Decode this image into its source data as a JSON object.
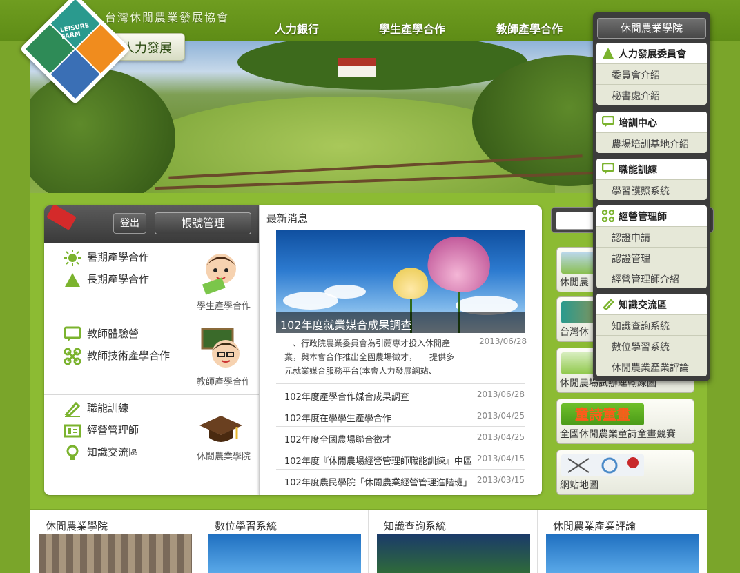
{
  "header": {
    "org_name": "台灣休閒農業發展協會",
    "logo_text": "LEISURE FARM",
    "site_tag": "人力發展",
    "nav": [
      {
        "label": "人力銀行"
      },
      {
        "label": "學生產學合作"
      },
      {
        "label": "教師產學合作"
      },
      {
        "label": "休閒農業學院"
      }
    ]
  },
  "account": {
    "logout_label": "登出",
    "account_label": "帳號管理"
  },
  "left_sections": [
    {
      "links": [
        "暑期產學合作",
        "長期產學合作"
      ],
      "caption": "學生產學合作"
    },
    {
      "links": [
        "教師體驗營",
        "教師技術產學合作"
      ],
      "caption": "教師產學合作"
    },
    {
      "links": [
        "職能訓練",
        "經營管理師",
        "知識交流區"
      ],
      "caption": "休閒農業學院"
    }
  ],
  "news": {
    "title": "最新消息",
    "featured_caption": "102年度就業媒合成果調查",
    "featured_desc": "一、行政院農業委員會為引薦專才投入休閒產業，與本會合作推出全國農場徵才，　　提供多元就業媒合服務平台(本會人力發展網站、",
    "featured_date": "2013/06/28",
    "items": [
      {
        "title": "102年度產學合作媒合成果調查",
        "date": "2013/06/28"
      },
      {
        "title": "102年度在學學生產學合作",
        "date": "2013/04/25"
      },
      {
        "title": "102年度全國農場聯合徵才",
        "date": "2013/04/25"
      },
      {
        "title": "102年度『休閒農場經營管理師職能訓練』中區",
        "date": "2013/04/15"
      },
      {
        "title": "102年度農民學院「休閒農業經營管理進階班」",
        "date": "2013/03/15"
      }
    ]
  },
  "side_cards": [
    {
      "label": "休閒農"
    },
    {
      "label": "台灣休"
    },
    {
      "label": "休閒農場試辦運輸線圖"
    },
    {
      "label": "全國休閒農業童詩童畫競賽",
      "img_text": "童詩童畫"
    },
    {
      "label": "網站地圖"
    }
  ],
  "dropdown": {
    "head": "休閒農業學院",
    "groups": [
      {
        "title": "人力發展委員會",
        "icon": "triangle-icon",
        "items": [
          "委員會介紹",
          "秘書處介紹"
        ]
      },
      {
        "title": "培訓中心",
        "icon": "chat-icon",
        "items": [
          "農場培訓基地介紹"
        ]
      },
      {
        "title": "職能訓練",
        "icon": "chat-icon",
        "items": [
          "學習護照系統"
        ]
      },
      {
        "title": "經營管理師",
        "icon": "nodes-icon",
        "items": [
          "認證申請",
          "認證管理",
          "經營管理師介紹"
        ]
      },
      {
        "title": "知識交流區",
        "icon": "pencil-icon",
        "items": [
          "知識查詢系統",
          "數位學習系統",
          "休閒農業產業評論"
        ]
      }
    ]
  },
  "bottom_cards": [
    {
      "title": "休閒農業學院"
    },
    {
      "title": "數位學習系統"
    },
    {
      "title": "知識查詢系統"
    },
    {
      "title": "休閒農業產業評論"
    }
  ],
  "colors": {
    "background": "#7aa52a",
    "menu_dark": "#3c3c3c",
    "accent_red": "#d42a2a"
  }
}
